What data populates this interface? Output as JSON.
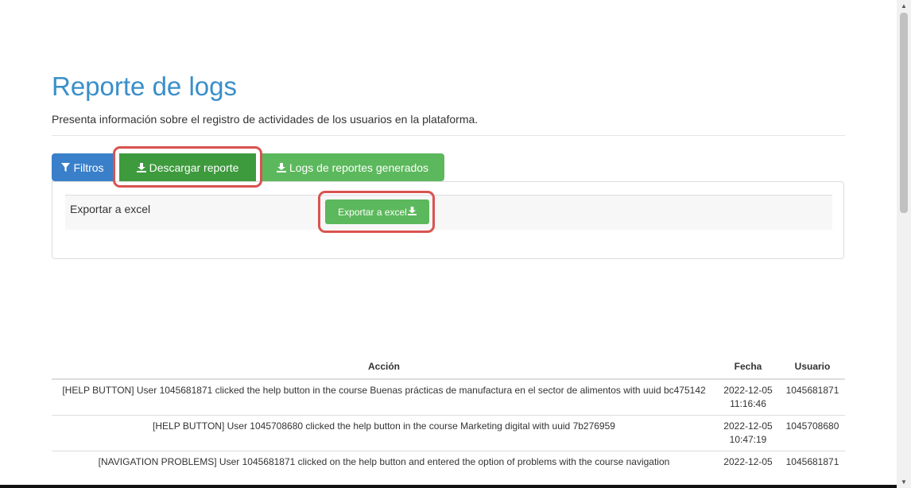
{
  "page": {
    "title": "Reporte de logs",
    "subtitle": "Presenta información sobre el registro de actividades de los usuarios en la plataforma."
  },
  "tabs": {
    "filtros": "Filtros",
    "descargar": "Descargar reporte",
    "logs": "Logs de reportes generados"
  },
  "export": {
    "label": "Exportar a excel",
    "button": "Exportar a excel"
  },
  "table": {
    "headers": {
      "accion": "Acción",
      "fecha": "Fecha",
      "usuario": "Usuario"
    },
    "rows": [
      {
        "accion": "[HELP BUTTON] User 1045681871 clicked the help button in the course Buenas prácticas de manufactura en el sector de alimentos with uuid bc475142",
        "fecha": "2022-12-05 11:16:46",
        "usuario": "1045681871"
      },
      {
        "accion": "[HELP BUTTON] User 1045708680 clicked the help button in the course Marketing digital with uuid 7b276959",
        "fecha": "2022-12-05 10:47:19",
        "usuario": "1045708680"
      },
      {
        "accion": "[NAVIGATION PROBLEMS] User 1045681871 clicked on the help button and entered the option of problems with the course navigation",
        "fecha": "2022-12-05",
        "usuario": "1045681871"
      }
    ]
  },
  "icons": {
    "filter": "filter-icon",
    "download": "download-icon"
  },
  "colors": {
    "title": "#3a8fc9",
    "primary": "#3a7fc9",
    "success": "#5cb85c",
    "success_active": "#3d9a3d",
    "highlight": "#d9534f"
  }
}
